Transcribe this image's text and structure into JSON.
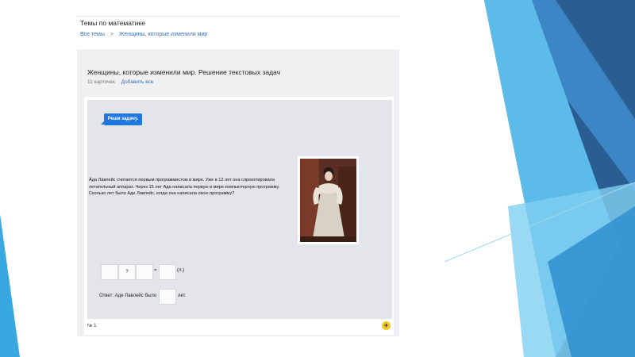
{
  "header": {
    "title": "Темы по математике",
    "breadcrumbs": [
      "Все темы",
      "Женщины, которые изменили мир"
    ],
    "separator": ">"
  },
  "deck": {
    "title": "Женщины, которые изменили мир. Решение текстовых задач",
    "count": "11 карточек",
    "add_all": "Добавить все"
  },
  "card": {
    "bubble": "Реши задачу.",
    "problem": "А́да Ла́влейс считается первым программистом в мире. Уже в 12 лет она спроектировала летательный аппарат. Через 15 лет Ада написала первую в мире компьютерную программу. Сколько лет было Аде Лавлейс, когда она написала свою программу?",
    "equation": {
      "box1": "",
      "op": "?",
      "box3": "",
      "eq": "=",
      "box4": "",
      "unit": "(л.)"
    },
    "answer_label": "Ответ: Аде Лавлейс было",
    "answer_unit": "лет.",
    "number": "№ 1",
    "add_button": "+"
  },
  "colors": {
    "accent_blue": "#1f77e0",
    "yellow_button": "#f7c81c",
    "slide_blue_dark": "#2c6fa8",
    "slide_blue_light": "#4fb7e8"
  }
}
